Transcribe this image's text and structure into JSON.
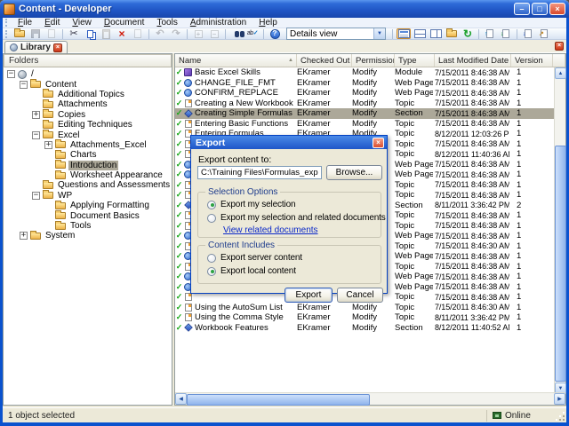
{
  "window": {
    "title": "Content - Developer",
    "controls": [
      "minimize",
      "maximize",
      "close"
    ]
  },
  "menu": {
    "items": [
      "File",
      "Edit",
      "View",
      "Document",
      "Tools",
      "Administration",
      "Help"
    ]
  },
  "toolbar": {
    "groups": [
      {
        "icons": [
          {
            "name": "open-icon"
          },
          {
            "name": "save-icon",
            "disabled": true
          },
          {
            "name": "preview-icon",
            "disabled": true
          }
        ]
      },
      {
        "icons": [
          {
            "name": "cut-icon"
          },
          {
            "name": "copy-icon"
          },
          {
            "name": "paste-icon",
            "disabled": true
          },
          {
            "name": "delete-icon"
          },
          {
            "name": "properties-icon",
            "disabled": true
          }
        ]
      },
      {
        "icons": [
          {
            "name": "undo-icon",
            "disabled": true
          },
          {
            "name": "redo-icon",
            "disabled": true
          }
        ]
      },
      {
        "icons": [
          {
            "name": "expand-all-icon",
            "disabled": true
          },
          {
            "name": "collapse-all-icon",
            "disabled": true
          }
        ]
      },
      {
        "icons": [
          {
            "name": "find-icon"
          },
          {
            "name": "spellcheck-icon"
          }
        ]
      },
      {
        "icons": [
          {
            "name": "help-icon"
          }
        ]
      }
    ],
    "view_select_value": "Details view",
    "view_groups": [
      {
        "icons": [
          {
            "name": "view-details-icon",
            "active": true
          },
          {
            "name": "view-split-horizontal-icon"
          },
          {
            "name": "view-split-vertical-icon"
          },
          {
            "name": "open-location-icon"
          },
          {
            "name": "refresh-icon"
          }
        ]
      },
      {
        "icons": [
          {
            "name": "checkout-icon"
          },
          {
            "name": "checkin-icon"
          }
        ]
      },
      {
        "icons": [
          {
            "name": "import-icon"
          },
          {
            "name": "export-icon"
          }
        ]
      }
    ]
  },
  "tab": {
    "label": "Library"
  },
  "folders_panel": {
    "header": "Folders",
    "items": [
      {
        "label": "/",
        "level": 0,
        "expander": "minus",
        "icon": "root"
      },
      {
        "label": "Content",
        "level": 1,
        "expander": "minus",
        "icon": "folder"
      },
      {
        "label": "Additional Topics",
        "level": 2,
        "icon": "folder"
      },
      {
        "label": "Attachments",
        "level": 2,
        "icon": "folder"
      },
      {
        "label": "Copies",
        "level": 2,
        "expander": "plus",
        "icon": "folder"
      },
      {
        "label": "Editing Techniques",
        "level": 2,
        "icon": "folder"
      },
      {
        "label": "Excel",
        "level": 2,
        "expander": "minus",
        "icon": "folder"
      },
      {
        "label": "Attachments_Excel",
        "level": 3,
        "expander": "plus",
        "icon": "folder"
      },
      {
        "label": "Charts",
        "level": 3,
        "icon": "folder"
      },
      {
        "label": "Introduction",
        "level": 3,
        "icon": "folder",
        "selected": true
      },
      {
        "label": "Worksheet Appearance",
        "level": 3,
        "icon": "folder"
      },
      {
        "label": "Questions and Assessments",
        "level": 2,
        "icon": "folder"
      },
      {
        "label": "WP",
        "level": 2,
        "expander": "minus",
        "icon": "folder"
      },
      {
        "label": "Applying Formatting",
        "level": 3,
        "icon": "folder"
      },
      {
        "label": "Document Basics",
        "level": 3,
        "icon": "folder"
      },
      {
        "label": "Tools",
        "level": 3,
        "icon": "folder"
      },
      {
        "label": "System",
        "level": 1,
        "expander": "plus",
        "icon": "folder"
      }
    ]
  },
  "list": {
    "columns": [
      "Name",
      "Checked Out By",
      "Permission",
      "Type",
      "Last Modified Date",
      "Version"
    ],
    "sorted_by": "Name",
    "rows": [
      {
        "name": "Basic Excel Skills",
        "checked_out_by": "EKramer",
        "permission": "Modify",
        "type": "Module",
        "modified": "7/15/2011 8:46:38 AM",
        "version": "1",
        "icon": "module"
      },
      {
        "name": "CHANGE_FILE_FMT",
        "checked_out_by": "EKramer",
        "permission": "Modify",
        "type": "Web Page",
        "modified": "7/15/2011 8:46:38 AM",
        "version": "1",
        "icon": "webpage"
      },
      {
        "name": "CONFIRM_REPLACE",
        "checked_out_by": "EKramer",
        "permission": "Modify",
        "type": "Web Page",
        "modified": "7/15/2011 8:46:38 AM",
        "version": "1",
        "icon": "webpage"
      },
      {
        "name": "Creating a New Workbook",
        "checked_out_by": "EKramer",
        "permission": "Modify",
        "type": "Topic",
        "modified": "7/15/2011 8:46:38 AM",
        "version": "1",
        "icon": "topic"
      },
      {
        "name": "Creating Simple Formulas",
        "checked_out_by": "EKramer",
        "permission": "Modify",
        "type": "Section",
        "modified": "7/15/2011 8:46:38 AM",
        "version": "1",
        "icon": "section",
        "selected": true
      },
      {
        "name": "Entering Basic Functions",
        "checked_out_by": "EKramer",
        "permission": "Modify",
        "type": "Topic",
        "modified": "7/15/2011 8:46:38 AM",
        "version": "1",
        "icon": "topic"
      },
      {
        "name": "Entering Formulas",
        "checked_out_by": "EKramer",
        "permission": "Modify",
        "type": "Topic",
        "modified": "8/12/2011 12:03:26 PM",
        "version": "1",
        "icon": "topic"
      },
      {
        "name": "",
        "checked_out_by": "",
        "permission": "",
        "type": "Topic",
        "modified": "7/15/2011 8:46:38 AM",
        "version": "1",
        "icon": "topic"
      },
      {
        "name": "",
        "checked_out_by": "",
        "permission": "",
        "type": "Topic",
        "modified": "8/12/2011 11:40:36 AM",
        "version": "1",
        "icon": "topic"
      },
      {
        "name": "",
        "checked_out_by": "",
        "permission": "",
        "type": "Web Page",
        "modified": "7/15/2011 8:46:38 AM",
        "version": "1",
        "icon": "webpage"
      },
      {
        "name": "",
        "checked_out_by": "",
        "permission": "",
        "type": "Web Page",
        "modified": "7/15/2011 8:46:38 AM",
        "version": "1",
        "icon": "webpage"
      },
      {
        "name": "",
        "checked_out_by": "",
        "permission": "",
        "type": "Topic",
        "modified": "7/15/2011 8:46:38 AM",
        "version": "1",
        "icon": "topic"
      },
      {
        "name": "",
        "checked_out_by": "",
        "permission": "",
        "type": "Topic",
        "modified": "7/15/2011 8:46:38 AM",
        "version": "1",
        "icon": "topic"
      },
      {
        "name": "",
        "checked_out_by": "",
        "permission": "",
        "type": "Section",
        "modified": "8/11/2011 3:36:42 PM",
        "version": "2",
        "icon": "section"
      },
      {
        "name": "",
        "checked_out_by": "",
        "permission": "",
        "type": "Topic",
        "modified": "7/15/2011 8:46:38 AM",
        "version": "1",
        "icon": "topic"
      },
      {
        "name": "",
        "checked_out_by": "",
        "permission": "",
        "type": "Topic",
        "modified": "7/15/2011 8:46:38 AM",
        "version": "1",
        "icon": "topic"
      },
      {
        "name": "",
        "checked_out_by": "",
        "permission": "",
        "type": "Web Page",
        "modified": "7/15/2011 8:46:38 AM",
        "version": "1",
        "icon": "webpage"
      },
      {
        "name": "",
        "checked_out_by": "",
        "permission": "",
        "type": "Topic",
        "modified": "7/15/2011 8:46:30 AM",
        "version": "1",
        "icon": "topic"
      },
      {
        "name": "",
        "checked_out_by": "",
        "permission": "",
        "type": "Web Page",
        "modified": "7/15/2011 8:46:38 AM",
        "version": "1",
        "icon": "webpage"
      },
      {
        "name": "",
        "checked_out_by": "",
        "permission": "",
        "type": "Topic",
        "modified": "7/15/2011 8:46:38 AM",
        "version": "1",
        "icon": "topic"
      },
      {
        "name": "",
        "checked_out_by": "",
        "permission": "",
        "type": "Web Page",
        "modified": "7/15/2011 8:46:38 AM",
        "version": "1",
        "icon": "webpage"
      },
      {
        "name": "",
        "checked_out_by": "",
        "permission": "",
        "type": "Web Page",
        "modified": "7/15/2011 8:46:38 AM",
        "version": "1",
        "icon": "webpage"
      },
      {
        "name": "",
        "checked_out_by": "",
        "permission": "",
        "type": "Topic",
        "modified": "7/15/2011 8:46:38 AM",
        "version": "1",
        "icon": "topic"
      },
      {
        "name": "Using the AutoSum List",
        "checked_out_by": "EKramer",
        "permission": "Modify",
        "type": "Topic",
        "modified": "7/15/2011 8:46:30 AM",
        "version": "1",
        "icon": "topic"
      },
      {
        "name": "Using the Comma Style",
        "checked_out_by": "EKramer",
        "permission": "Modify",
        "type": "Topic",
        "modified": "8/11/2011 3:36:42 PM",
        "version": "1",
        "icon": "topic"
      },
      {
        "name": "Workbook Features",
        "checked_out_by": "EKramer",
        "permission": "Modify",
        "type": "Section",
        "modified": "8/12/2011 11:40:52 AM",
        "version": "1",
        "icon": "section"
      }
    ]
  },
  "dialog": {
    "title": "Export",
    "path_label": "Export content to:",
    "path_value": "C:\\Training Files\\Formulas_export.odarc",
    "browse_label": "Browse...",
    "selection": {
      "title": "Selection Options",
      "options": [
        {
          "label": "Export my selection",
          "selected": true
        },
        {
          "label": "Export my selection and related documents",
          "selected": false
        }
      ],
      "link": "View related documents"
    },
    "content": {
      "title": "Content Includes",
      "options": [
        {
          "label": "Export server content",
          "selected": false
        },
        {
          "label": "Export local content",
          "selected": true
        }
      ]
    },
    "export_label": "Export",
    "cancel_label": "Cancel"
  },
  "statusbar": {
    "left": "1 object selected",
    "right": "Online"
  },
  "colors": {
    "titlebar_blue": "#2E6BD8",
    "window_border": "#0A52CE",
    "inactive_selection": "#ACA899",
    "check_green": "#18A818",
    "link_blue": "#0A28C8",
    "dialog_bg": "#ECE9D8"
  }
}
